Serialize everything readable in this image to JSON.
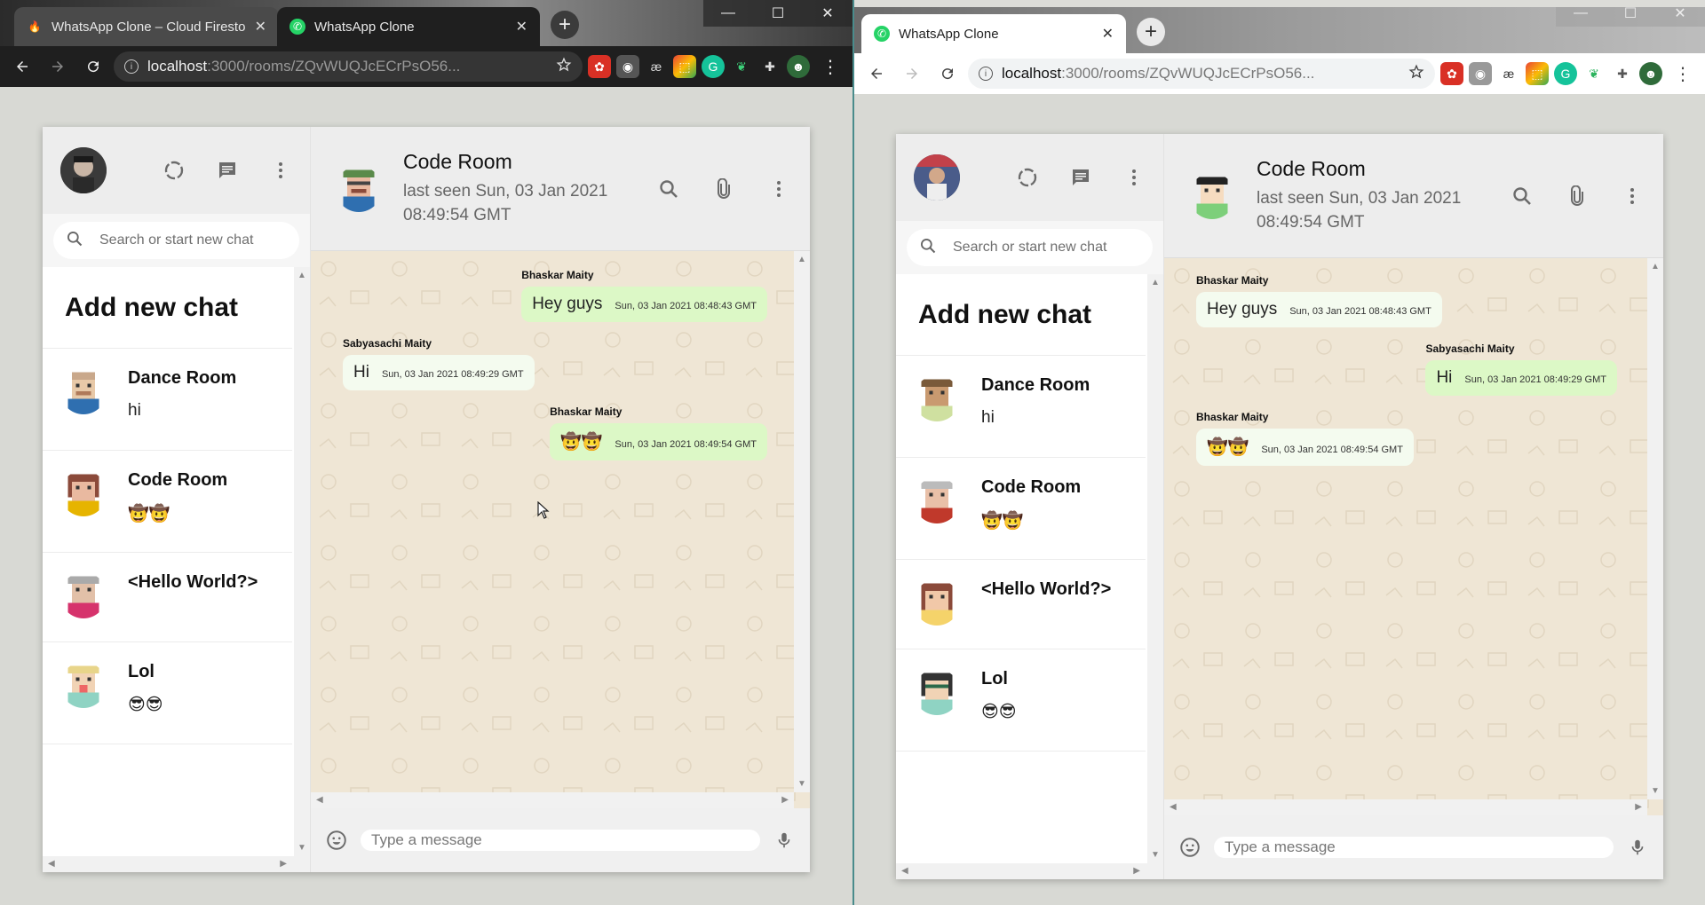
{
  "browser_left": {
    "tabs": [
      {
        "title": "WhatsApp Clone – Cloud Firestor",
        "close": "✕",
        "favicon": "🔥",
        "active": false
      },
      {
        "title": "WhatsApp Clone",
        "close": "✕",
        "favicon": "✆",
        "active": true
      }
    ],
    "new_tab": "+",
    "url_host": "localhost",
    "url_path": ":3000/rooms/ZQvWUQJcECrPsO56..."
  },
  "browser_right": {
    "tabs": [
      {
        "title": "WhatsApp Clone",
        "close": "✕",
        "favicon": "✆",
        "active": true
      }
    ],
    "new_tab": "+",
    "url_host": "localhost",
    "url_path": ":3000/rooms/ZQvWUQJcECrPsO56..."
  },
  "window_controls": {
    "minimize": "—",
    "maximize": "☐",
    "close": "✕"
  },
  "app_left": {
    "search_placeholder": "Search or start new chat",
    "add_new_chat": "Add new chat",
    "chats": [
      {
        "name": "Dance Room",
        "last": "hi"
      },
      {
        "name": "Code Room",
        "last": "🤠🤠"
      },
      {
        "name": "<Hello World?>",
        "last": ""
      },
      {
        "name": "Lol",
        "last": "😎😎"
      }
    ],
    "room": {
      "name": "Code Room",
      "last_seen": "last seen Sun, 03 Jan 2021 08:49:54 GMT"
    },
    "messages": [
      {
        "sender": "Bhaskar Maity",
        "text": "Hey guys",
        "time": "Sun, 03 Jan 2021 08:48:43 GMT",
        "own": true
      },
      {
        "sender": "Sabyasachi Maity",
        "text": "Hi",
        "time": "Sun, 03 Jan 2021 08:49:29 GMT",
        "own": false
      },
      {
        "sender": "Bhaskar Maity",
        "text": "🤠🤠",
        "time": "Sun, 03 Jan 2021 08:49:54 GMT",
        "own": true
      }
    ],
    "input_placeholder": "Type a message"
  },
  "app_right": {
    "search_placeholder": "Search or start new chat",
    "add_new_chat": "Add new chat",
    "chats": [
      {
        "name": "Dance Room",
        "last": "hi"
      },
      {
        "name": "Code Room",
        "last": "🤠🤠"
      },
      {
        "name": "<Hello World?>",
        "last": ""
      },
      {
        "name": "Lol",
        "last": "😎😎"
      }
    ],
    "room": {
      "name": "Code Room",
      "last_seen": "last seen Sun, 03 Jan 2021 08:49:54 GMT"
    },
    "messages": [
      {
        "sender": "Bhaskar Maity",
        "text": "Hey guys",
        "time": "Sun, 03 Jan 2021 08:48:43 GMT",
        "own": false
      },
      {
        "sender": "Sabyasachi Maity",
        "text": "Hi",
        "time": "Sun, 03 Jan 2021 08:49:29 GMT",
        "own": true
      },
      {
        "sender": "Bhaskar Maity",
        "text": "🤠🤠",
        "time": "Sun, 03 Jan 2021 08:49:54 GMT",
        "own": false
      }
    ],
    "input_placeholder": "Type a message"
  },
  "icons": {
    "back": "back-arrow-icon",
    "forward": "forward-arrow-icon",
    "reload": "reload-icon",
    "star": "star-icon",
    "status": "status-ring-icon",
    "new_chat": "chat-bubble-icon",
    "menu": "more-vert-icon",
    "search": "search-icon",
    "attach": "attach-icon",
    "emoji": "emoji-icon",
    "mic": "mic-icon"
  },
  "colors": {
    "own_bubble": "#dcf8c6",
    "other_bubble": "#ffffff",
    "chat_bg": "#efe6d5",
    "header_bg": "#ededed"
  }
}
